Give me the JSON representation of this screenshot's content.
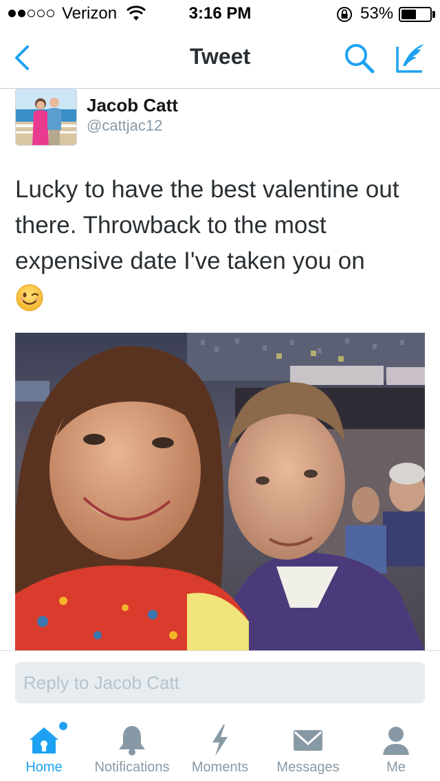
{
  "status_bar": {
    "carrier": "Verizon",
    "time": "3:16 PM",
    "battery_percent": "53%",
    "battery_level": 0.53,
    "signal_bars_filled": 2,
    "signal_bars_total": 5
  },
  "nav": {
    "title": "Tweet",
    "back_icon": "chevron-left-icon",
    "search_icon": "search-icon",
    "compose_icon": "compose-tweet-icon"
  },
  "tweet": {
    "author_name": "Jacob Catt",
    "author_handle": "@cattjac12",
    "text": "Lucky to have the best valentine out there. Throwback to the most expensive date I've taken you on",
    "emoji": "winking-face-emoji"
  },
  "reply": {
    "placeholder": "Reply to Jacob Catt"
  },
  "tabs": [
    {
      "label": "Home",
      "icon": "home-icon",
      "active": true
    },
    {
      "label": "Notifications",
      "icon": "bell-icon",
      "active": false
    },
    {
      "label": "Moments",
      "icon": "lightning-icon",
      "active": false
    },
    {
      "label": "Messages",
      "icon": "envelope-icon",
      "active": false
    },
    {
      "label": "Me",
      "icon": "person-icon",
      "active": false
    }
  ],
  "colors": {
    "accent": "#1da1f2",
    "inactive": "#8899a6",
    "reply_bg": "#e6ecf0"
  }
}
